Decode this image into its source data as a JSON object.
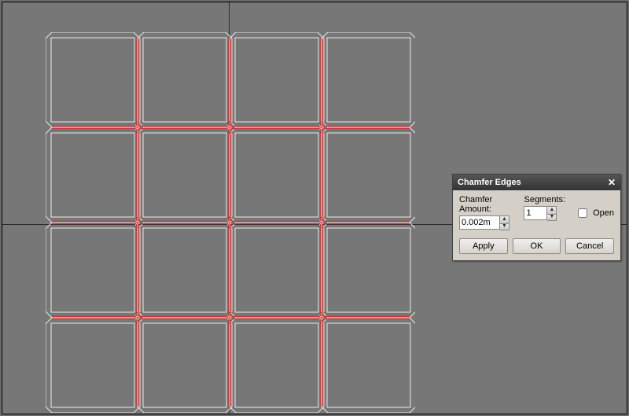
{
  "dialog": {
    "title": "Chamfer Edges",
    "chamfer_label": "Chamfer Amount:",
    "chamfer_value": "0.002m",
    "segments_label": "Segments:",
    "segments_value": "1",
    "open_label": "Open",
    "apply_label": "Apply",
    "ok_label": "OK",
    "cancel_label": "Cancel"
  }
}
